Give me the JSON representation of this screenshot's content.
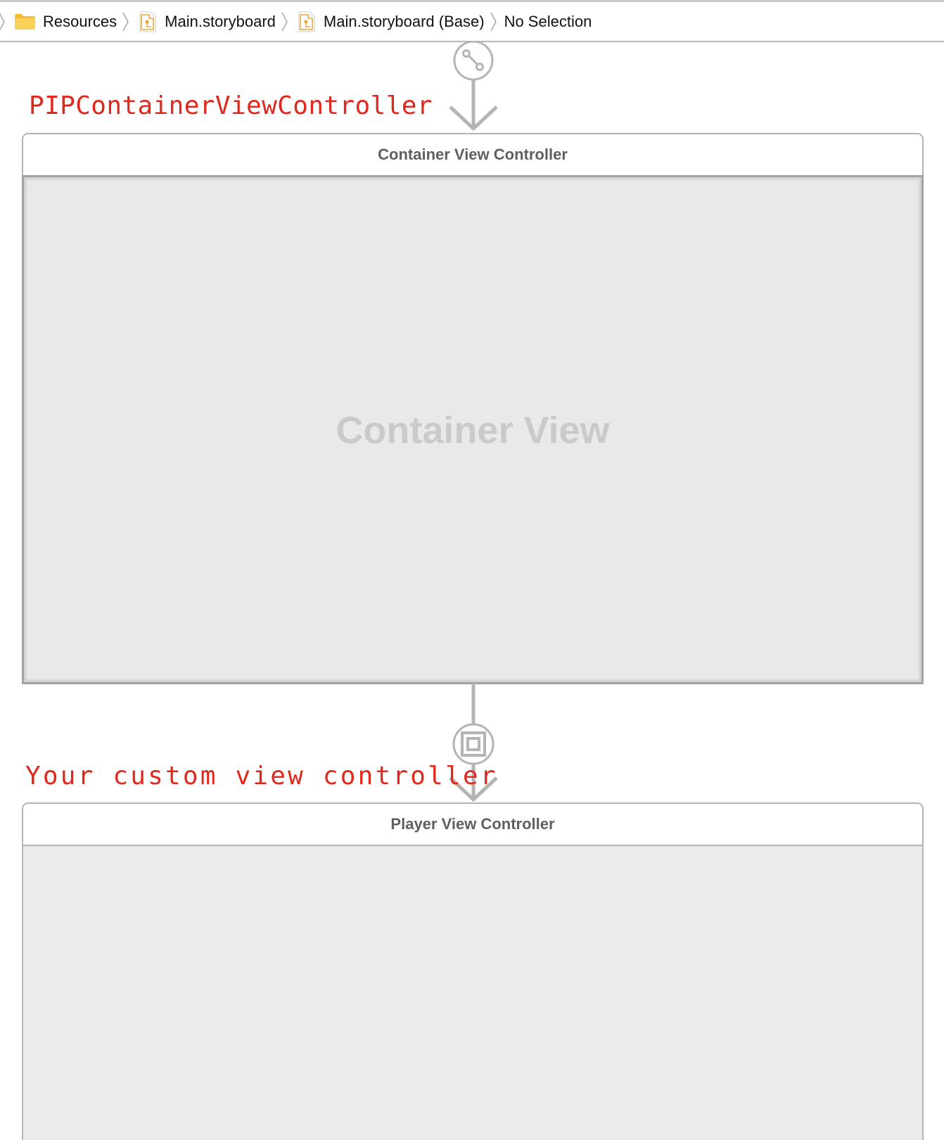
{
  "breadcrumb": {
    "items": [
      {
        "label": "Resources",
        "icon": "folder-icon"
      },
      {
        "label": "Main.storyboard",
        "icon": "storyboard-file-icon"
      },
      {
        "label": "Main.storyboard (Base)",
        "icon": "storyboard-file-icon"
      },
      {
        "label": "No Selection",
        "icon": null
      }
    ]
  },
  "annotations": {
    "top": "PIPContainerViewController",
    "bottom": "Your custom view controller"
  },
  "scenes": {
    "container": {
      "title": "Container View Controller",
      "content_label": "Container View"
    },
    "player": {
      "title": "Player View Controller"
    }
  },
  "segues": {
    "entry": {
      "icon": "entry-segue-icon"
    },
    "embed": {
      "icon": "embed-segue-icon"
    }
  },
  "colors": {
    "annotation": "#e0281c",
    "segue": "#b4b4b4",
    "folder": "#f6c744",
    "storyboard_icon": "#e8a93a"
  }
}
